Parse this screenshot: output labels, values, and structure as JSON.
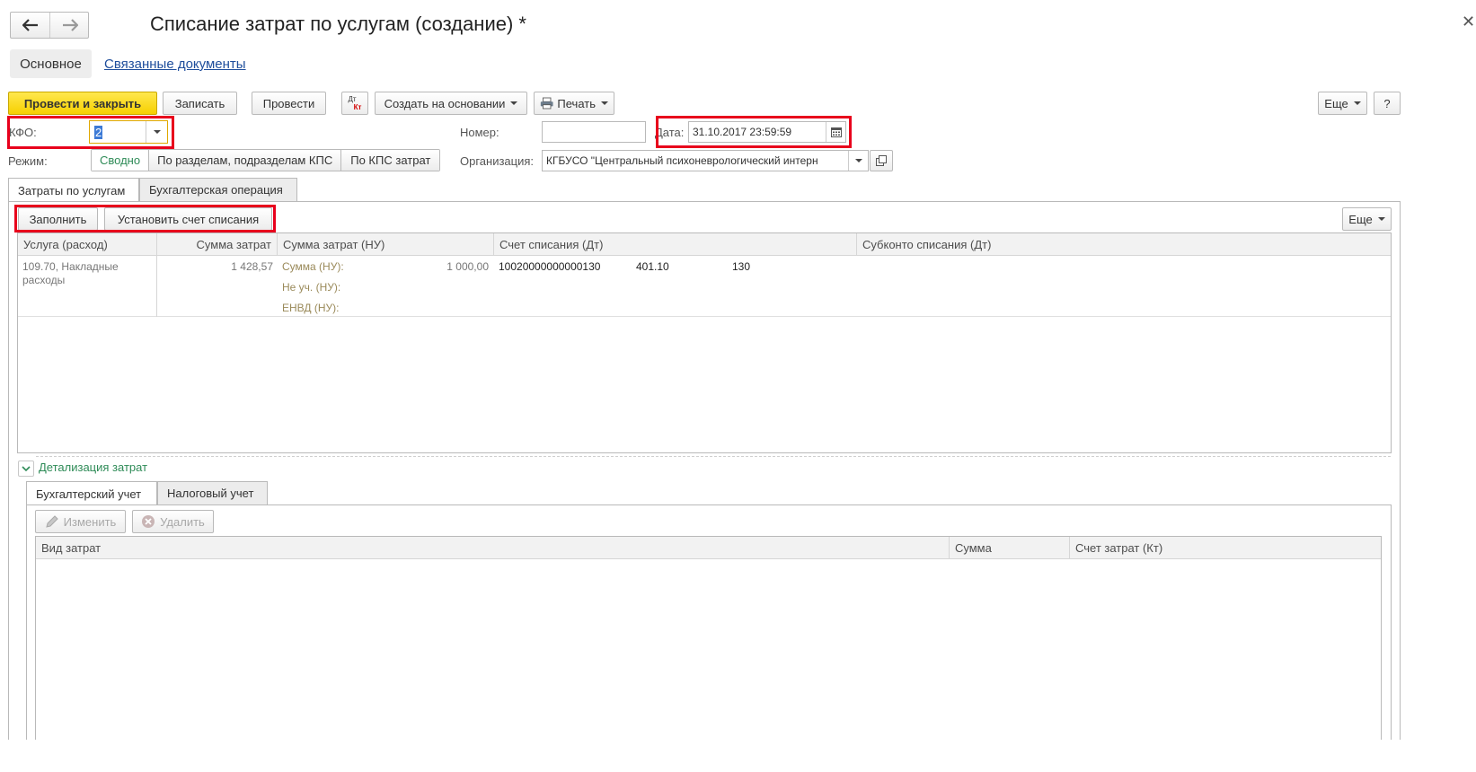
{
  "window": {
    "title": "Списание затрат по услугам (создание) *"
  },
  "nav_tabs": {
    "main": "Основное",
    "related": "Связанные документы"
  },
  "toolbar": {
    "post_close": "Провести и закрыть",
    "save": "Записать",
    "post": "Провести",
    "dtkt_top": "Дт",
    "dtkt_bottom": "Кт",
    "create_based": "Создать на основании",
    "print": "Печать",
    "more": "Еще",
    "help": "?"
  },
  "form": {
    "kfo_label": "КФО:",
    "kfo_value": "2",
    "number_label": "Номер:",
    "number_value": "",
    "date_label": "Дата:",
    "date_value": "31.10.2017 23:59:59",
    "mode_label": "Режим:",
    "mode_options": [
      "Сводно",
      "По разделам, подразделам КПС",
      "По КПС затрат"
    ],
    "mode_selected": "Сводно",
    "org_label": "Организация:",
    "org_value": "КГБУСО \"Центральный психоневрологический интерн"
  },
  "content_tabs": {
    "costs": "Затраты по услугам",
    "accounting_op": "Бухгалтерская операция"
  },
  "table_toolbar": {
    "fill": "Заполнить",
    "set_account": "Установить счет списания",
    "more": "Еще"
  },
  "table": {
    "columns": [
      "Услуга (расход)",
      "Сумма затрат",
      "Сумма затрат (НУ)",
      "Счет списания (Дт)",
      "Субконто списания (Дт)"
    ],
    "rows": [
      {
        "service": "109.70, Накладные расходы",
        "amount": "1 428,57",
        "nu_sum_label": "Сумма (НУ):",
        "nu_sum_value": "1 000,00",
        "nu_notacc_label": "Не уч. (НУ):",
        "nu_envd_label": "ЕНВД (НУ):",
        "account_code": "10020000000000130",
        "account_num": "401.10",
        "account_kosgu": "130"
      }
    ]
  },
  "detail": {
    "title": "Детализация затрат",
    "tabs": [
      "Бухгалтерский учет",
      "Налоговый учет"
    ],
    "edit": "Изменить",
    "delete": "Удалить",
    "columns": [
      "Вид затрат",
      "Сумма",
      "Счет затрат (Кт)"
    ]
  },
  "colors": {
    "accent_yellow": "#f6cf00",
    "highlight_red": "#e8001c",
    "link_blue": "#1f4e9c",
    "green_text": "#2e8b57"
  }
}
